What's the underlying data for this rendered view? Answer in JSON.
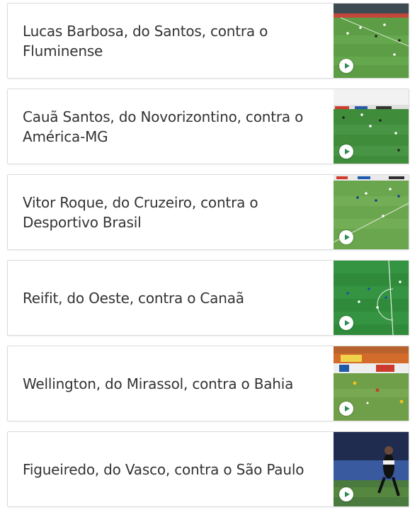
{
  "videos": [
    {
      "title": "Lucas Barbosa, do Santos, contra o Fluminense"
    },
    {
      "title": "Cauã Santos, do Novorizontino, contra o América-MG"
    },
    {
      "title": "Vitor Roque, do Cruzeiro, contra o Desportivo Brasil"
    },
    {
      "title": "Reifit, do Oeste, contra o Canaã"
    },
    {
      "title": "Wellington, do Mirassol, contra o Bahia"
    },
    {
      "title": "Figueiredo, do Vasco, contra o São Paulo"
    }
  ],
  "icons": {
    "play": "play-icon"
  },
  "colors": {
    "title": "#333333",
    "border": "#dcdcdc",
    "pitch": "#4e8f3a",
    "play": "#2e8b57"
  }
}
